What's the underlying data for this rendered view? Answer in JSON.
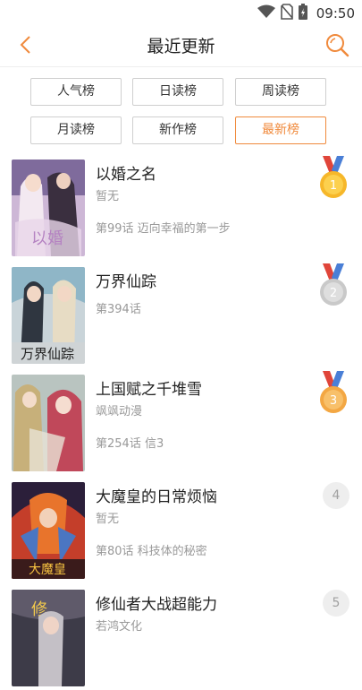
{
  "status": {
    "time": "09:50"
  },
  "header": {
    "title": "最近更新"
  },
  "tabs": [
    {
      "label": "人气榜",
      "active": false
    },
    {
      "label": "日读榜",
      "active": false
    },
    {
      "label": "周读榜",
      "active": false
    },
    {
      "label": "月读榜",
      "active": false
    },
    {
      "label": "新作榜",
      "active": false
    },
    {
      "label": "最新榜",
      "active": true
    }
  ],
  "items": [
    {
      "title": "以婚之名",
      "author": "暂无",
      "chapter": "第99话 迈向幸福的第一步",
      "rank": "1",
      "rank_style": "gold"
    },
    {
      "title": "万界仙踪",
      "author": "",
      "chapter": "第394话",
      "rank": "2",
      "rank_style": "silver"
    },
    {
      "title": "上国赋之千堆雪",
      "author": "飒飒动漫",
      "chapter": "第254话 信3",
      "rank": "3",
      "rank_style": "bronze"
    },
    {
      "title": "大魔皇的日常烦恼",
      "author": "暂无",
      "chapter": "第80话 科技体的秘密",
      "rank": "4",
      "rank_style": "plain"
    },
    {
      "title": "修仙者大战超能力",
      "author": "若鸿文化",
      "chapter": "",
      "rank": "5",
      "rank_style": "plain"
    }
  ],
  "colors": {
    "accent": "#f08a3c",
    "gold": "#f6b72a",
    "silver": "#c9c9c9",
    "bronze": "#f3a743",
    "ribbon_red": "#e0453a",
    "ribbon_blue": "#4a7fd6"
  }
}
